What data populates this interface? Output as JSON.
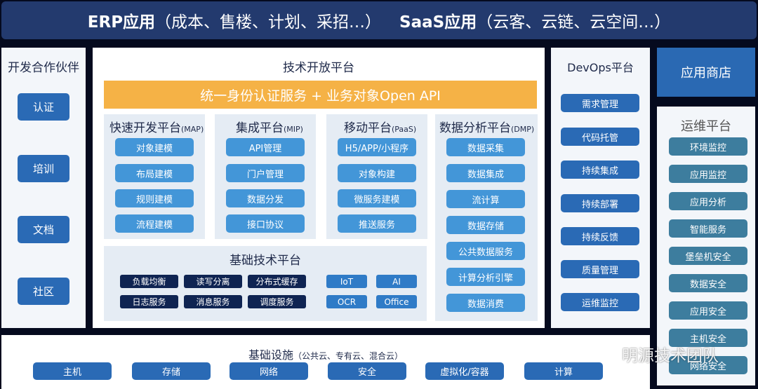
{
  "top_banner": {
    "erp_label": "ERP应用",
    "erp_detail": "（成本、售楼、计划、采招…）",
    "saas_label": "SaaS应用",
    "saas_detail": "（云客、云链、云空间…）"
  },
  "partners": {
    "title": "开发合作伙伴",
    "items": [
      "认证",
      "培训",
      "文档",
      "社区"
    ]
  },
  "tech_open_platform": {
    "title": "技术开放平台",
    "banner": "统一身份认证服务 + 业务对象Open API",
    "platforms": [
      {
        "name": "快速开发平台",
        "abbr": "(MAP)",
        "items": [
          "对象建模",
          "布局建模",
          "规则建模",
          "流程建模"
        ]
      },
      {
        "name": "集成平台",
        "abbr": "(MIP)",
        "items": [
          "API管理",
          "门户管理",
          "数据分发",
          "接口协议"
        ]
      },
      {
        "name": "移动平台",
        "abbr": "(PaaS)",
        "items": [
          "H5/APP/小程序",
          "对象构建",
          "微服务建模",
          "推送服务"
        ]
      },
      {
        "name": "数据分析平台",
        "abbr": "(DMP)",
        "items": [
          "数据采集",
          "数据集成",
          "流计算",
          "数据存储",
          "公共数据服务",
          "计算分析引擎",
          "数据消费"
        ]
      }
    ],
    "base_platform": {
      "title": "基础技术平台",
      "core_items": [
        "负载均衡",
        "读写分离",
        "分布式缓存",
        "日志服务",
        "消息服务",
        "调度服务"
      ],
      "ext_items": [
        "IoT",
        "AI",
        "OCR",
        "Office"
      ]
    }
  },
  "devops": {
    "title": "DevOps平台",
    "items": [
      "需求管理",
      "代码托管",
      "持续集成",
      "持续部署",
      "持续反馈",
      "质量管理",
      "运维监控"
    ]
  },
  "app_store": {
    "label": "应用商店"
  },
  "ops": {
    "title": "运维平台",
    "items": [
      "环境监控",
      "应用监控",
      "应用分析",
      "智能服务",
      "堡垒机安全",
      "数据安全",
      "应用安全",
      "主机安全",
      "网络安全"
    ]
  },
  "infrastructure": {
    "title": "基础设施",
    "subtitle": "（公共云、专有云、混合云）",
    "items": [
      "主机",
      "存储",
      "网络",
      "安全",
      "虚拟化/容器",
      "计算"
    ]
  },
  "watermark": {
    "text": "明源技术团队",
    "icon": "wechat-icon"
  },
  "colors": {
    "banner_bg": "#233a6e",
    "orange": "#f5b246",
    "button_blue": "#2a6ab5",
    "button_light_blue": "#4396d8",
    "button_teal": "#3d7d9e",
    "button_navy": "#0f2452"
  }
}
